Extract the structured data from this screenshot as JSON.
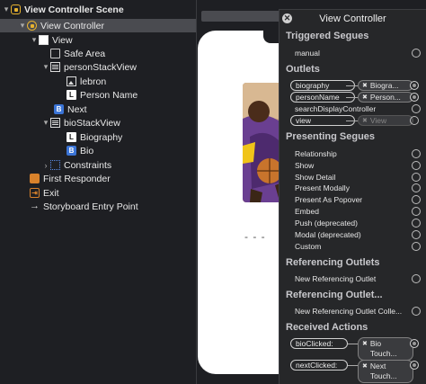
{
  "outline": {
    "items": [
      {
        "label": "View Controller Scene",
        "icon": "scene-icon",
        "disclosure": "▾",
        "bold": true
      },
      {
        "label": "View Controller",
        "icon": "view-controller-icon",
        "disclosure": "▾"
      },
      {
        "label": "View",
        "icon": "view-icon",
        "disclosure": "▾"
      },
      {
        "label": "Safe Area",
        "icon": "safe-area-icon",
        "disclosure": ""
      },
      {
        "label": "personStackView",
        "icon": "stack-view-icon",
        "disclosure": "▾"
      },
      {
        "label": "lebron",
        "icon": "image-view-icon",
        "disclosure": ""
      },
      {
        "label": "Person Name",
        "icon": "label-icon",
        "disclosure": "",
        "glyph": "L"
      },
      {
        "label": "Next",
        "icon": "button-icon",
        "disclosure": "",
        "glyph": "B"
      },
      {
        "label": "bioStackView",
        "icon": "stack-view-icon",
        "disclosure": "▾"
      },
      {
        "label": "Biography",
        "icon": "label-icon",
        "disclosure": "",
        "glyph": "L"
      },
      {
        "label": "Bio",
        "icon": "button-icon",
        "disclosure": "",
        "glyph": "B"
      },
      {
        "label": "Constraints",
        "icon": "constraints-icon",
        "disclosure": "›"
      },
      {
        "label": "First Responder",
        "icon": "first-responder-icon",
        "disclosure": ""
      },
      {
        "label": "Exit",
        "icon": "exit-icon",
        "disclosure": "",
        "glyph": "⇥"
      },
      {
        "label": "Storyboard Entry Point",
        "icon": "arrow-right-icon",
        "disclosure": "",
        "glyph": "→"
      }
    ]
  },
  "canvas": {
    "dots": "- - -"
  },
  "popover": {
    "title": "View Controller",
    "close_glyph": "✕",
    "sections": {
      "triggered_segues": "Triggered Segues",
      "outlets": "Outlets",
      "presenting_segues": "Presenting Segues",
      "referencing_outlets": "Referencing Outlets",
      "referencing_outlet_collections": "Referencing Outlet...",
      "received_actions": "Received Actions"
    },
    "triggered": [
      "manual"
    ],
    "outlets": [
      {
        "name": "biography",
        "target": "Biogra...",
        "connected": true
      },
      {
        "name": "personName",
        "target": "Person...",
        "connected": true
      },
      {
        "name": "searchDisplayController",
        "target": "",
        "connected": false
      },
      {
        "name": "view",
        "target": "View",
        "connected": true
      }
    ],
    "presenting": [
      "Relationship",
      "Show",
      "Show Detail",
      "Present Modally",
      "Present As Popover",
      "Embed",
      "Push (deprecated)",
      "Modal (deprecated)",
      "Custom"
    ],
    "new_referencing_outlet": "New Referencing Outlet",
    "new_referencing_collection": "New Referencing Outlet Colle...",
    "actions": [
      {
        "name": "bioClicked:",
        "target_line1": "Bio",
        "target_line2": "Touch..."
      },
      {
        "name": "nextClicked:",
        "target_line1": "Next",
        "target_line2": "Touch..."
      }
    ],
    "x_glyph": "✖"
  }
}
